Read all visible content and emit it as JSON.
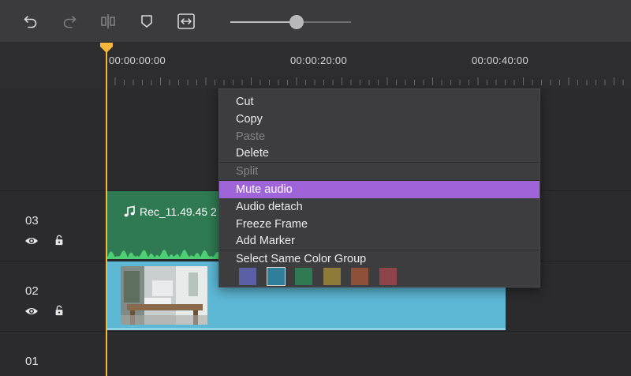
{
  "toolbar": {
    "icons": [
      "undo-icon",
      "redo-icon",
      "split-icon",
      "marker-icon",
      "fit-width-icon"
    ],
    "zoom_level": 0.55
  },
  "ruler": {
    "labels": [
      "00:00:00:00",
      "00:00:20:00",
      "00:00:40:00"
    ]
  },
  "tracks": [
    {
      "number": "03"
    },
    {
      "number": "02"
    },
    {
      "number": "01"
    }
  ],
  "clips": {
    "audio": {
      "title": "Rec_11.49.45 2",
      "color": "#2f7a52"
    },
    "video": {
      "color": "#5db8d6"
    }
  },
  "playhead": {
    "color": "#f6b73c"
  },
  "context_menu": {
    "items": [
      {
        "label": "Cut",
        "state": "normal"
      },
      {
        "label": "Copy",
        "state": "normal"
      },
      {
        "label": "Paste",
        "state": "disabled"
      },
      {
        "label": "Delete",
        "state": "normal"
      },
      {
        "label": "Split",
        "state": "disabled"
      },
      {
        "label": "Mute audio",
        "state": "highlighted"
      },
      {
        "label": "Audio detach",
        "state": "normal"
      },
      {
        "label": "Freeze Frame",
        "state": "normal"
      },
      {
        "label": "Add Marker",
        "state": "normal"
      },
      {
        "label": "Select Same Color Group",
        "state": "normal"
      }
    ],
    "highlight_color": "#a064d9",
    "swatches": [
      "#5a5fa6",
      "#2f7f9a",
      "#2f7a52",
      "#8e7b3a",
      "#8e5038",
      "#8e4448"
    ],
    "selected_swatch": 1
  }
}
